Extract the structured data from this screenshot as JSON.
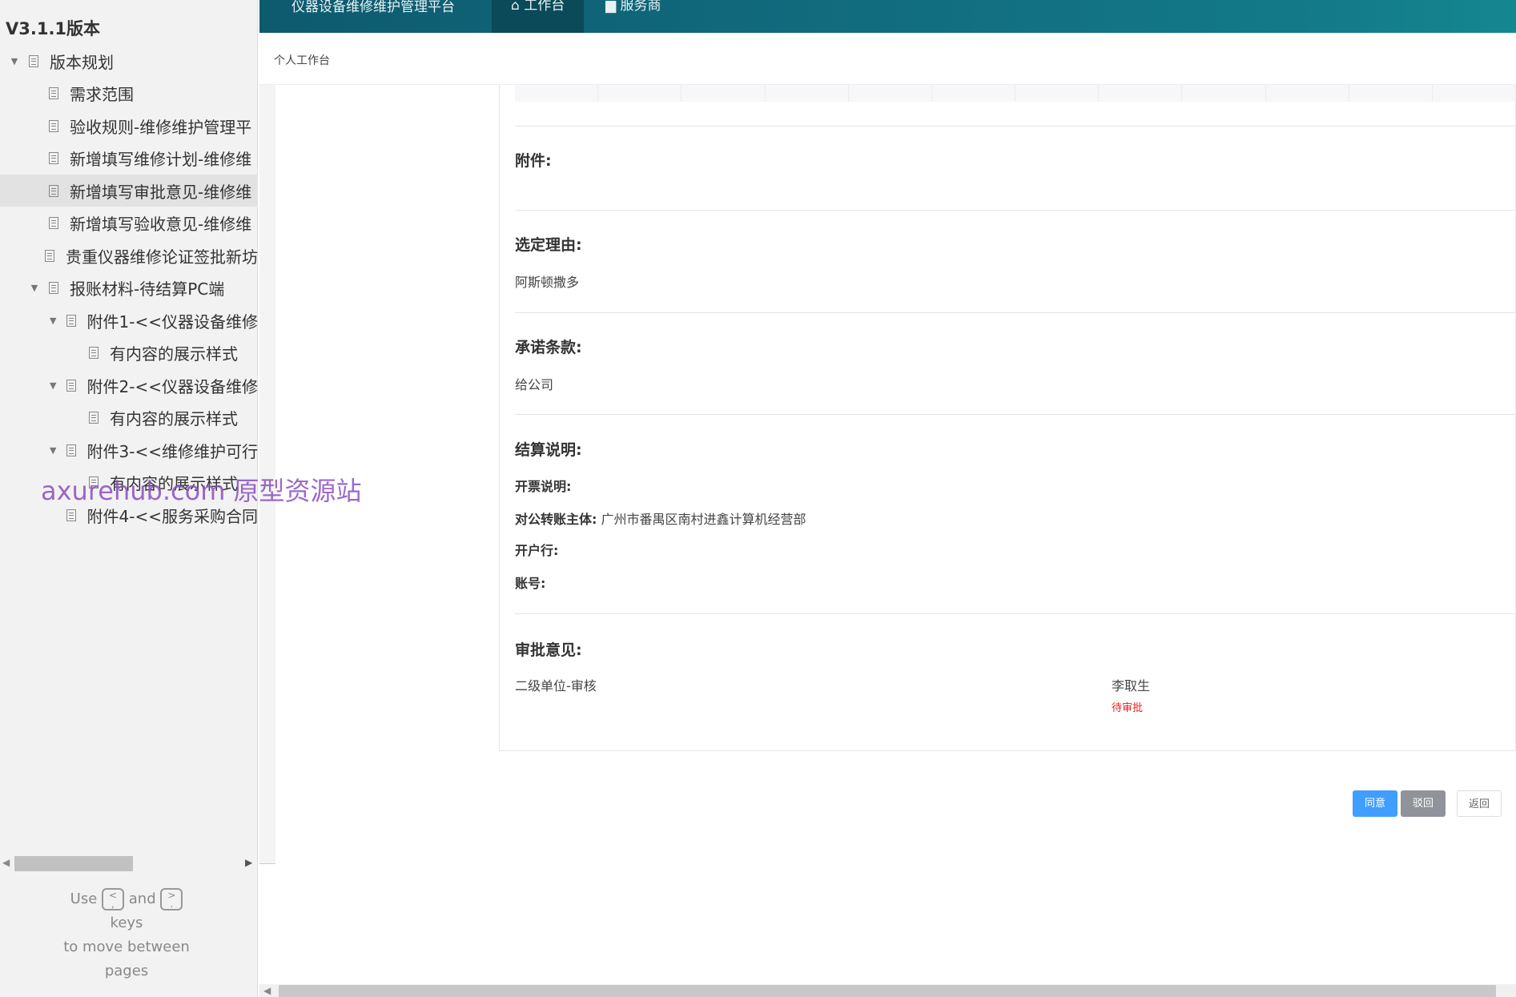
{
  "sidebar": {
    "version": "V3.1.1版本",
    "items": [
      {
        "label": "版本规划",
        "level": 0,
        "expanded": true
      },
      {
        "label": "需求范围",
        "level": 1
      },
      {
        "label": "验收规则-维修维护管理平",
        "level": 1
      },
      {
        "label": "新增填写维修计划-维修维",
        "level": 1
      },
      {
        "label": "新增填写审批意见-维修维",
        "level": 1,
        "selected": true
      },
      {
        "label": "新增填写验收意见-维修维",
        "level": 1
      },
      {
        "label": "贵重仪器维修论证签批新坊",
        "level": 1
      },
      {
        "label": "报账材料-待结算PC端",
        "level": 1,
        "expanded": true
      },
      {
        "label": "附件1-<<仪器设备维修",
        "level": 2,
        "expanded": true
      },
      {
        "label": "有内容的展示样式",
        "level": 3
      },
      {
        "label": "附件2-<<仪器设备维修",
        "level": 2,
        "expanded": true
      },
      {
        "label": "有内容的展示样式",
        "level": 3
      },
      {
        "label": "附件3-<<维修维护可行",
        "level": 2,
        "expanded": true
      },
      {
        "label": "有内容的展示样式",
        "level": 3
      },
      {
        "label": "附件4-<<服务采购合同",
        "level": 2
      }
    ],
    "help": {
      "use": "Use",
      "key1": "<",
      "key1b": ",",
      "and": "and",
      "key2": ">",
      "key2b": ".",
      "keys": "keys",
      "move": "to move between",
      "pages": "pages"
    }
  },
  "header": {
    "title": "仪器设备维修维护管理平台",
    "tabs": [
      {
        "label": "工作台",
        "icon": "home-icon",
        "active": true
      },
      {
        "label": "服务商",
        "icon": "store-icon"
      }
    ],
    "color": "#0e5a6e"
  },
  "breadcrumb": "个人工作台",
  "detail": {
    "attachments": {
      "label": "附件:",
      "value": ""
    },
    "reason": {
      "label": "选定理由:",
      "value": "阿斯顿撒多"
    },
    "terms": {
      "label": "承诺条款:",
      "value": "给公司"
    },
    "settlement": {
      "label": "结算说明:",
      "invoice_label": "开票说明:",
      "invoice": "",
      "payee_label": "对公转账主体:",
      "payee": "广州市番禺区南村进鑫计算机经营部",
      "bank_label": "开户行:",
      "bank": "",
      "account_label": "账号:",
      "account": ""
    },
    "approval": {
      "label": "审批意见:",
      "step": "二级单位-审核",
      "approver": "李取生",
      "status": "待审批",
      "status_color": "#e02020"
    }
  },
  "actions": {
    "agree": "同意",
    "reject": "驳回",
    "back": "返回",
    "agree_color": "#409eff",
    "reject_color": "#909399"
  },
  "watermark": "axurehub.com 原型资源站"
}
